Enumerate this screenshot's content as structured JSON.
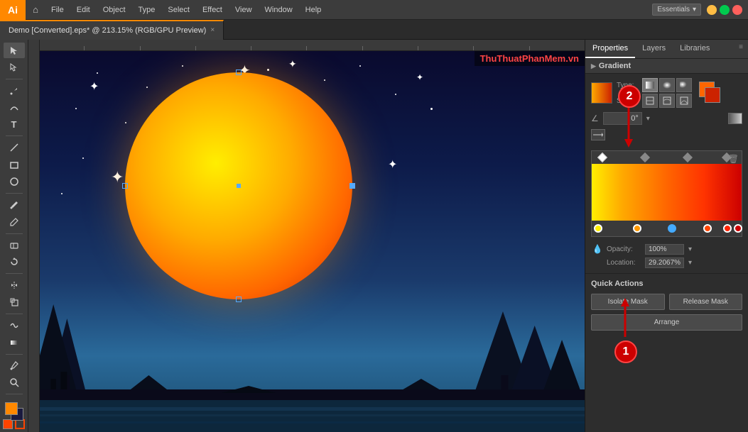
{
  "app": {
    "logo": "Ai",
    "title": "Demo [Converted].eps* @ 213.15% (RGB/GPU Preview)"
  },
  "menubar": {
    "items": [
      "File",
      "Edit",
      "Object",
      "Type",
      "Select",
      "Effect",
      "View",
      "Window",
      "Help"
    ],
    "workspace": "Essentials",
    "logo_bg": "#ff8800"
  },
  "tabbar": {
    "tab_title": "Demo [Converted].eps* @ 213.15% (RGB/GPU Preview)",
    "close_label": "×"
  },
  "panel_tabs": {
    "properties": "Properties",
    "layers": "Layers",
    "libraries": "Libraries"
  },
  "gradient_panel": {
    "title": "Gradient",
    "type_label": "Type:",
    "stroke_label": "Stroke:",
    "angle_label": "0°",
    "opacity_label": "Opacity:",
    "opacity_value": "100%",
    "location_label": "Location:",
    "location_value": "29.2067%"
  },
  "quick_actions": {
    "title": "Quick Actions",
    "isolate_mask": "Isolate Mask",
    "release_mask": "Release Mask",
    "arrange": "Arrange"
  },
  "annotations": {
    "circle1": "1",
    "circle2": "2"
  },
  "watermark": "ThuThuatPhanMem.vn"
}
